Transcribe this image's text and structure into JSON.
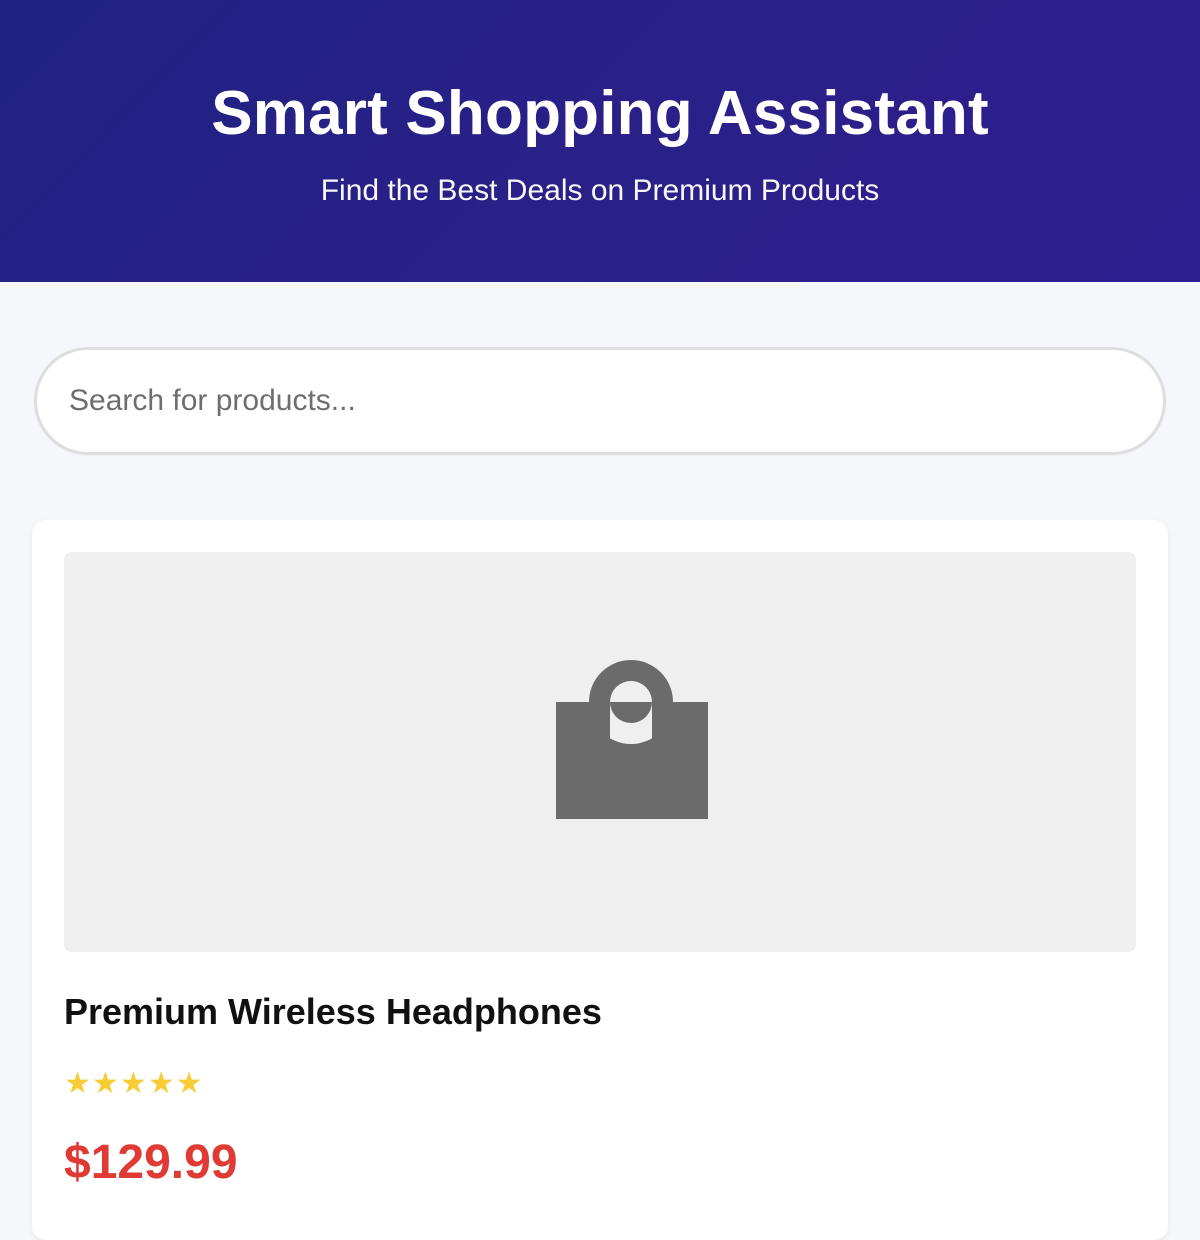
{
  "header": {
    "title": "Smart Shopping Assistant",
    "subtitle": "Find the Best Deals on Premium Products"
  },
  "search": {
    "placeholder": "Search for products...",
    "value": ""
  },
  "product": {
    "image_icon": "shopping-bag-icon",
    "name": "Premium Wireless Headphones",
    "rating": 5,
    "rating_max": 5,
    "price": "$129.99"
  },
  "colors": {
    "header_start": "#1f2281",
    "header_end": "#2e1d8f",
    "page_background": "#f6f7fb",
    "star": "#f7cc35",
    "price": "#e03a35",
    "icon": "#6b6b6b"
  }
}
